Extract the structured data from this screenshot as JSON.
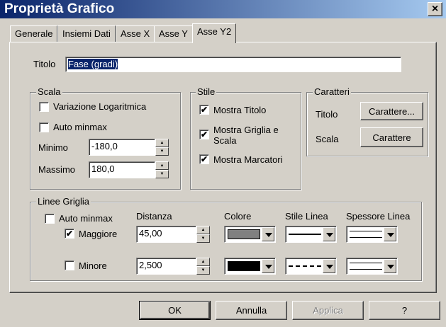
{
  "window": {
    "title": "Proprietà Grafico",
    "close": "×"
  },
  "tabs": [
    "Generale",
    "Insiemi Dati",
    "Asse X",
    "Asse Y",
    "Asse Y2"
  ],
  "titolo": {
    "label": "Titolo",
    "value": "Fase (gradi)"
  },
  "scala": {
    "legend": "Scala",
    "log": {
      "label": "Variazione Logaritmica",
      "checked": false
    },
    "auto": {
      "label": "Auto minmax",
      "checked": false
    },
    "minimo": {
      "label": "Minimo",
      "value": "-180,0"
    },
    "massimo": {
      "label": "Massimo",
      "value": "180,0"
    }
  },
  "stile": {
    "legend": "Stile",
    "mostra_titolo": {
      "label": "Mostra Titolo",
      "checked": true
    },
    "mostra_griglia": {
      "label1": "Mostra Griglia e",
      "label2": "Scala",
      "checked": true
    },
    "mostra_marcatori": {
      "label": "Mostra Marcatori",
      "checked": true
    }
  },
  "caratteri": {
    "legend": "Caratteri",
    "titolo_label": "Titolo",
    "titolo_button": "Carattere...",
    "scala_label": "Scala",
    "scala_button": "Carattere"
  },
  "linee": {
    "legend": "Linee Griglia",
    "auto": {
      "label": "Auto minmax",
      "checked": false
    },
    "headers": {
      "distanza": "Distanza",
      "colore": "Colore",
      "stile": "Stile Linea",
      "spessore": "Spessore Linea"
    },
    "maggiore": {
      "label": "Maggiore",
      "checked": true,
      "distanza": "45,00",
      "color": "#808080"
    },
    "minore": {
      "label": "Minore",
      "checked": false,
      "distanza": "2,500",
      "color": "#000000"
    }
  },
  "buttons": {
    "ok": "OK",
    "annulla": "Annulla",
    "applica": "Applica",
    "help": "?"
  }
}
